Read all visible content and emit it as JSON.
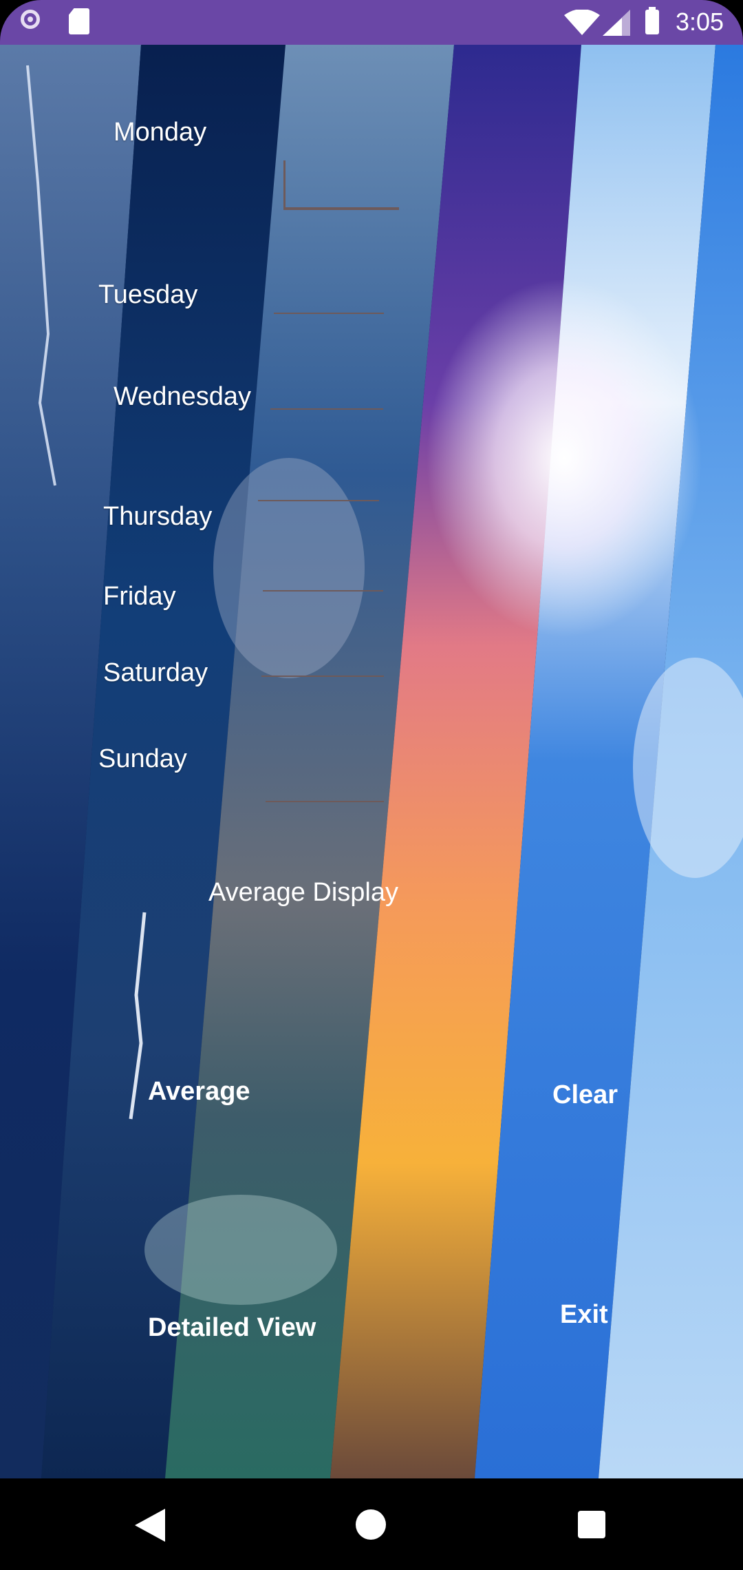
{
  "status_bar": {
    "time": "3:05",
    "icons": [
      "circle-icon",
      "sd-card-icon",
      "wifi-icon",
      "signal-icon",
      "battery-icon"
    ]
  },
  "days": [
    {
      "label": "Monday",
      "value": ""
    },
    {
      "label": "Tuesday",
      "value": ""
    },
    {
      "label": "Wednesday",
      "value": ""
    },
    {
      "label": "Thursday",
      "value": ""
    },
    {
      "label": "Friday",
      "value": ""
    },
    {
      "label": "Saturday",
      "value": ""
    },
    {
      "label": "Sunday",
      "value": ""
    }
  ],
  "average_display": {
    "label": "Average Display"
  },
  "buttons": {
    "average": "Average",
    "clear": "Clear",
    "detailed_view": "Detailed View",
    "exit": "Exit"
  },
  "nav_bar": {
    "icons": [
      "back-icon",
      "home-icon",
      "recents-icon"
    ]
  },
  "colors": {
    "status_bar": "#6a47a6",
    "input_underline": "#6e5a5a",
    "text": "#ffffff"
  }
}
